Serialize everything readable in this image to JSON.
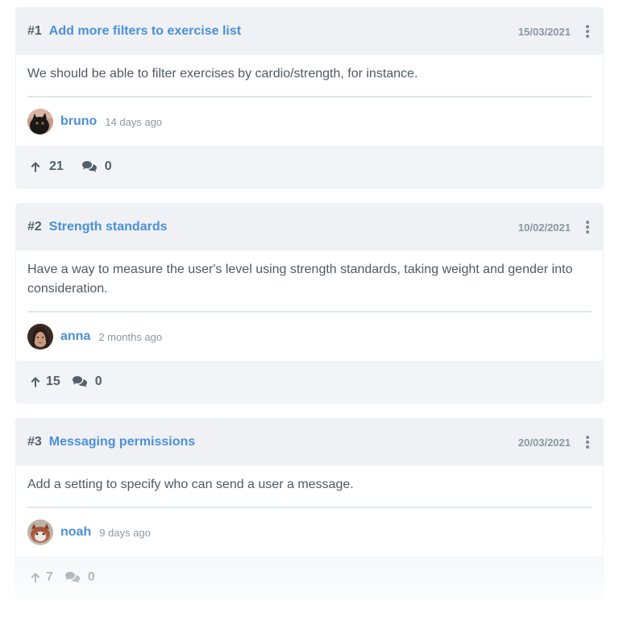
{
  "features": [
    {
      "number": "#1",
      "title": "Add more filters to exercise list",
      "date": "15/03/2021",
      "description": "We should be able to filter exercises by cardio/strength, for instance.",
      "author": "bruno",
      "ago": "14 days ago",
      "votes": "21",
      "comments": "0"
    },
    {
      "number": "#2",
      "title": "Strength standards",
      "date": "10/02/2021",
      "description": "Have a way to measure the user's level using strength standards, taking weight and gender into consideration.",
      "author": "anna",
      "ago": "2 months ago",
      "votes": "15",
      "comments": "0"
    },
    {
      "number": "#3",
      "title": "Messaging permissions",
      "date": "20/03/2021",
      "description": "Add a setting to specify who can send a user a message.",
      "author": "noah",
      "ago": "9 days ago",
      "votes": "7",
      "comments": "0"
    }
  ],
  "icons": {
    "vote": "arrow-up-icon",
    "comments": "comments-icon",
    "menu": "more-vertical-icon"
  },
  "colors": {
    "accent": "#4a90d9",
    "header_bg": "#eff1f4",
    "footer_bg": "#f2f4f7"
  }
}
